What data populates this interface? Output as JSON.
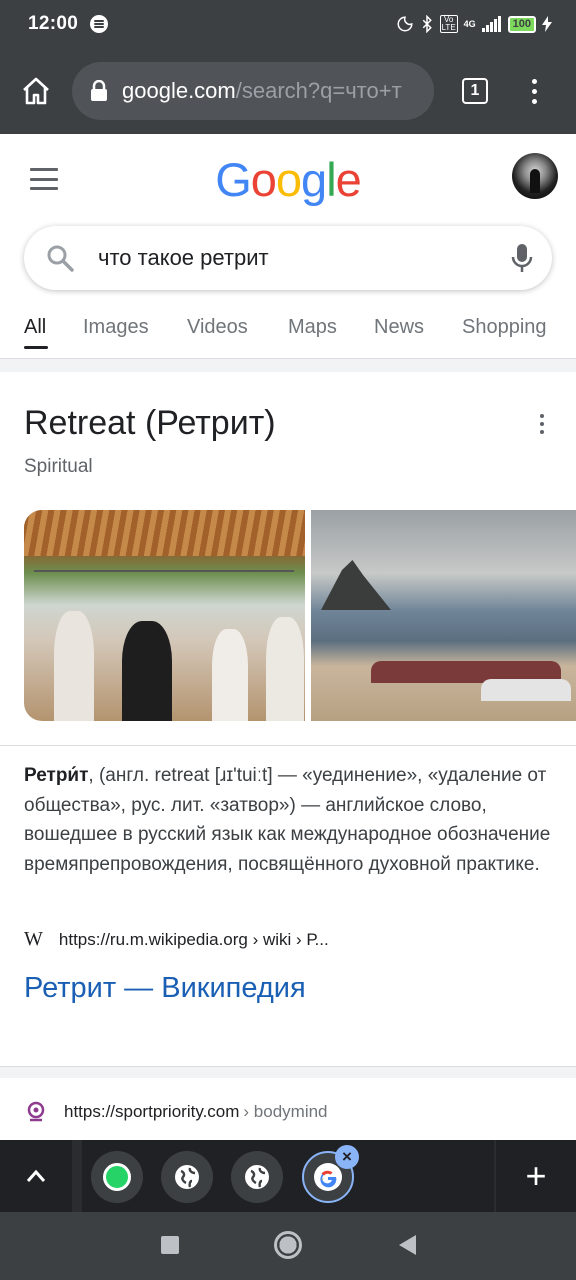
{
  "status_bar": {
    "time": "12:00",
    "network": "4G",
    "volte": "Vo LTE",
    "battery": "100"
  },
  "browser": {
    "url_host": "google.com",
    "url_rest": "/search?q=что+т",
    "tab_count": "1",
    "icons": [
      "home-icon",
      "lock-icon",
      "tabs-icon",
      "menu-icon"
    ]
  },
  "google": {
    "logo": [
      "G",
      "o",
      "o",
      "g",
      "l",
      "e"
    ],
    "logo_colors": [
      "#4285f4",
      "#ea4335",
      "#fbbc05",
      "#4285f4",
      "#34a853",
      "#ea4335"
    ],
    "query": "что такое ретрит",
    "tabs": [
      "All",
      "Images",
      "Videos",
      "Maps",
      "News",
      "Shopping"
    ],
    "active_tab": "All"
  },
  "knowledge_panel": {
    "title": "Retreat (Ретрит)",
    "subtitle": "Spiritual",
    "desc_bold": "Ретри́т",
    "desc_rest": ", (англ. retreat [ɹɪ'tuiːt] — «уединение», «удаление от общества», рус. лит. «затвор») — английское слово, вошедшее в русский язык как международное обозначение времяпрепровождения, посвящённого духовной практике.",
    "source_icon": "W",
    "source_url": "https://ru.m.wikipedia.org › wiki › Р...",
    "link_title": "Ретрит — Википедия"
  },
  "result2": {
    "host": "https://sportpriority.com",
    "path": "› bodymind"
  },
  "bubbles": {
    "items": [
      "whatsapp-bubble",
      "globe-bubble",
      "globe-bubble",
      "google-bubble"
    ],
    "close": "×",
    "plus": "+"
  }
}
